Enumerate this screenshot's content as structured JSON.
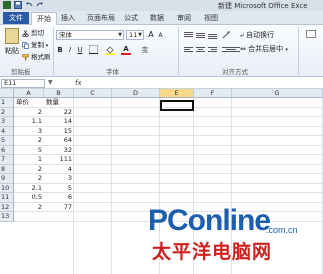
{
  "window": {
    "title": "新建 Microsoft Office Exce"
  },
  "ribbon": {
    "file_tab": "文件",
    "tabs": [
      "开始",
      "插入",
      "页面布局",
      "公式",
      "数据",
      "审阅",
      "视图"
    ],
    "clipboard": {
      "paste_label": "粘贴",
      "cut_label": "剪切",
      "copy_label": "复制",
      "format_painter_label": "格式刷",
      "group_label": "剪贴板"
    },
    "font": {
      "name": "宋体",
      "size": "11",
      "grow_label": "A",
      "shrink_label": "A",
      "bold_label": "B",
      "italic_label": "I",
      "underline_label": "U",
      "color_label": "A",
      "phonetic_label": "变",
      "group_label": "字体"
    },
    "alignment": {
      "wrap_label": "自动换行",
      "merge_label": "合并后居中",
      "group_label": "对齐方式"
    }
  },
  "formula_bar": {
    "cell_ref": "E11",
    "fx_label": "fx",
    "value": ""
  },
  "grid": {
    "columns": [
      "A",
      "B",
      "C",
      "D",
      "E",
      "F",
      "G"
    ],
    "selected_column": "E",
    "rows": [
      "1",
      "2",
      "3",
      "4",
      "5",
      "6",
      "7",
      "8",
      "9",
      "10",
      "11",
      "12",
      "13"
    ],
    "data": [
      {
        "a": "单价",
        "b": "数量"
      },
      {
        "a": "2",
        "b": "22"
      },
      {
        "a": "1.1",
        "b": "14"
      },
      {
        "a": "3",
        "b": "15"
      },
      {
        "a": "2",
        "b": "64"
      },
      {
        "a": "5",
        "b": "32"
      },
      {
        "a": "1",
        "b": "111"
      },
      {
        "a": "2",
        "b": "4"
      },
      {
        "a": "2",
        "b": "3"
      },
      {
        "a": "2.1",
        "b": "5"
      },
      {
        "a": "0.5",
        "b": "6"
      },
      {
        "a": "2",
        "b": "77"
      },
      {
        "a": "",
        "b": ""
      }
    ]
  },
  "watermark": {
    "brand": "PConline",
    "domain": ".com.cn",
    "chinese_name": "太平洋电脑网",
    "brand_color": "#1b5fae",
    "chinese_color": "#d01f1f"
  }
}
